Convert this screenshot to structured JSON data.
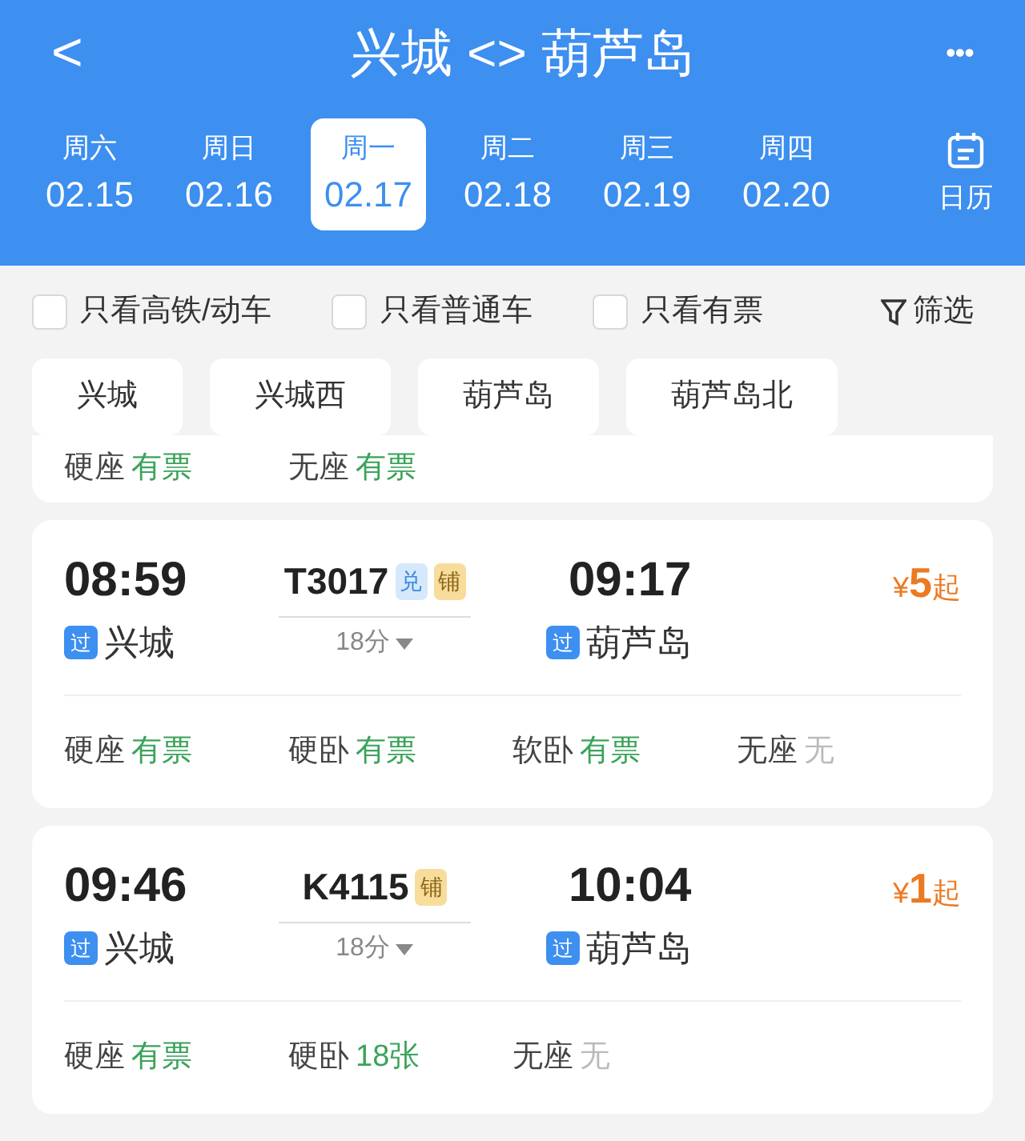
{
  "header": {
    "back": "<",
    "title": "兴城 <> 葫芦岛",
    "more": "•••"
  },
  "dates": [
    {
      "weekday": "周六",
      "date": "02.15",
      "selected": false
    },
    {
      "weekday": "周日",
      "date": "02.16",
      "selected": false
    },
    {
      "weekday": "周一",
      "date": "02.17",
      "selected": true
    },
    {
      "weekday": "周二",
      "date": "02.18",
      "selected": false
    },
    {
      "weekday": "周三",
      "date": "02.19",
      "selected": false
    },
    {
      "weekday": "周四",
      "date": "02.20",
      "selected": false
    }
  ],
  "calendar": {
    "label": "日历"
  },
  "filters": [
    {
      "label": "只看高铁/动车",
      "checked": false
    },
    {
      "label": "只看普通车",
      "checked": false
    },
    {
      "label": "只看有票",
      "checked": false
    }
  ],
  "filter_button": "筛选",
  "stations": [
    "兴城",
    "兴城西",
    "葫芦岛",
    "葫芦岛北"
  ],
  "partial_card": {
    "seats": [
      {
        "type": "硬座",
        "status": "有票",
        "available": true
      },
      {
        "type": "无座",
        "status": "有票",
        "available": true
      }
    ]
  },
  "trains": [
    {
      "depart_time": "08:59",
      "depart_tag": "过",
      "depart_station": "兴城",
      "number": "T3017",
      "badges": [
        {
          "label": "兑",
          "kind": "exchange"
        },
        {
          "label": "铺",
          "kind": "berth"
        }
      ],
      "duration": "18分",
      "arrive_time": "09:17",
      "arrive_tag": "过",
      "arrive_station": "葫芦岛",
      "price_symbol": "¥",
      "price": "5",
      "price_suffix": "起",
      "seats": [
        {
          "type": "硬座",
          "status": "有票",
          "available": true
        },
        {
          "type": "硬卧",
          "status": "有票",
          "available": true
        },
        {
          "type": "软卧",
          "status": "有票",
          "available": true
        },
        {
          "type": "无座",
          "status": "无",
          "available": false
        }
      ]
    },
    {
      "depart_time": "09:46",
      "depart_tag": "过",
      "depart_station": "兴城",
      "number": "K4115",
      "badges": [
        {
          "label": "铺",
          "kind": "berth"
        }
      ],
      "duration": "18分",
      "arrive_time": "10:04",
      "arrive_tag": "过",
      "arrive_station": "葫芦岛",
      "price_symbol": "¥",
      "price": "1",
      "price_suffix": "起",
      "seats": [
        {
          "type": "硬座",
          "status": "有票",
          "available": true
        },
        {
          "type": "硬卧",
          "status": "18张",
          "available": true
        },
        {
          "type": "无座",
          "status": "无",
          "available": false
        }
      ]
    }
  ]
}
